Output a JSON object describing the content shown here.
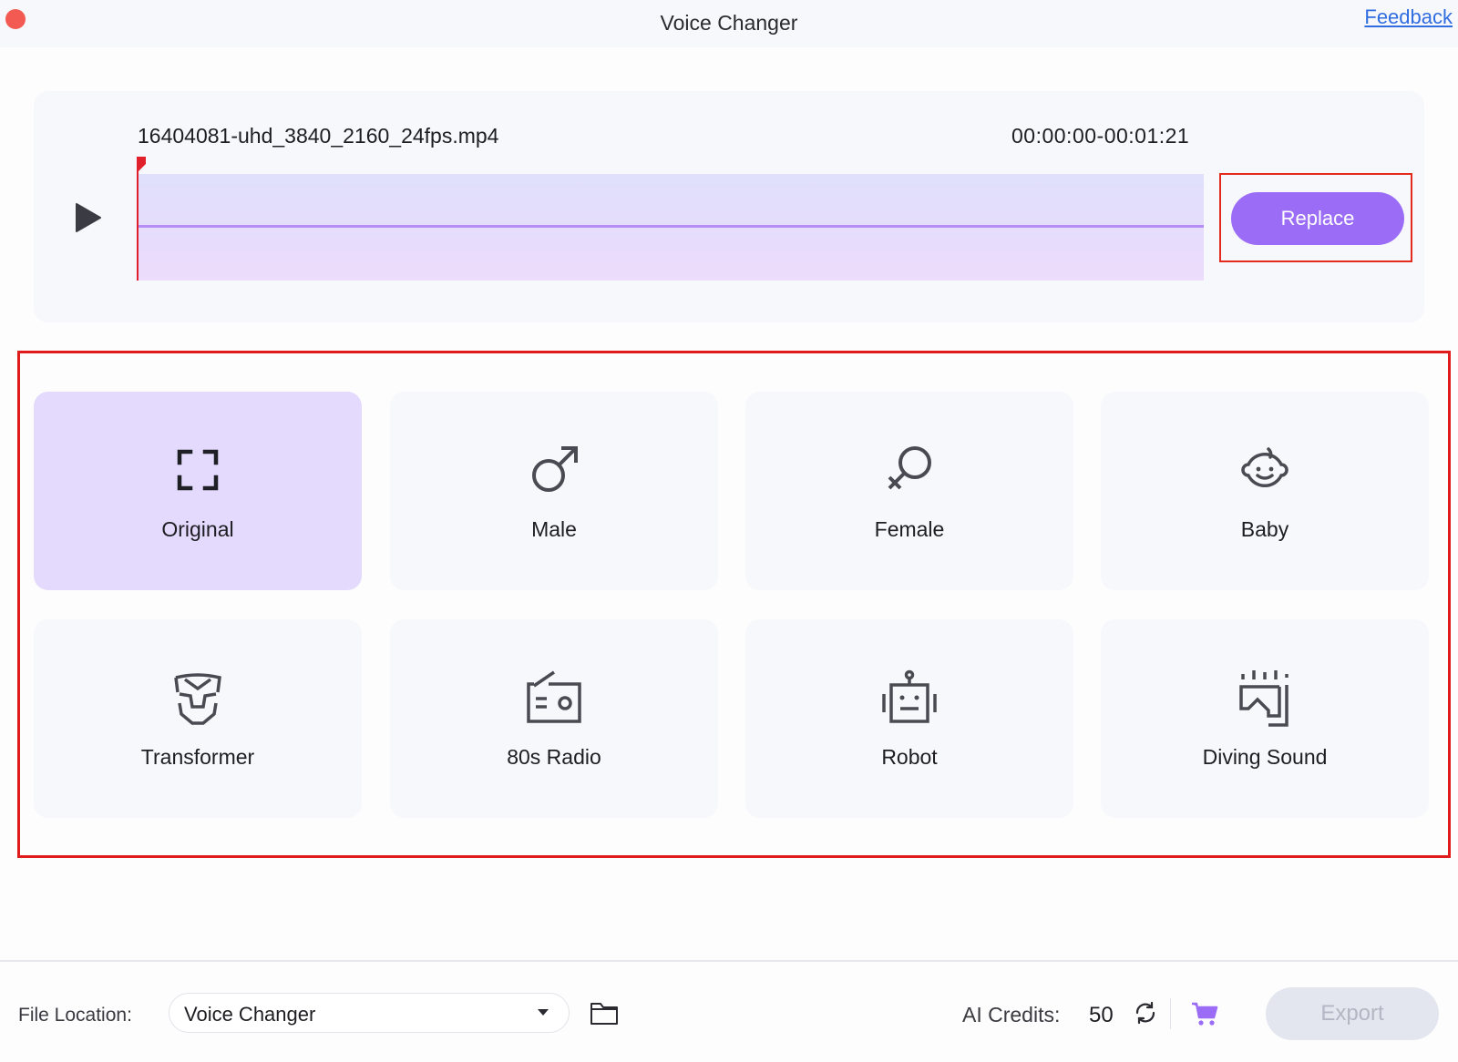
{
  "window": {
    "title": "Voice Changer",
    "feedback_link": "Feedback"
  },
  "media": {
    "file_name": "16404081-uhd_3840_2160_24fps.mp4",
    "time_range": "00:00:00-00:01:21",
    "playhead_position": 0,
    "replace_label": "Replace"
  },
  "effects": {
    "selected": "Original",
    "items": [
      {
        "label": "Original",
        "icon": "original-frame-icon",
        "selected": true
      },
      {
        "label": "Male",
        "icon": "male-symbol-icon",
        "selected": false
      },
      {
        "label": "Female",
        "icon": "female-symbol-icon",
        "selected": false
      },
      {
        "label": "Baby",
        "icon": "baby-face-icon",
        "selected": false
      },
      {
        "label": "Transformer",
        "icon": "transformer-mask-icon",
        "selected": false
      },
      {
        "label": "80s Radio",
        "icon": "radio-icon",
        "selected": false
      },
      {
        "label": "Robot",
        "icon": "robot-icon",
        "selected": false
      },
      {
        "label": "Diving Sound",
        "icon": "diving-mask-icon",
        "selected": false
      }
    ]
  },
  "footer": {
    "file_location_label": "File Location:",
    "file_location_value": "Voice Changer",
    "ai_credits_label": "AI Credits:",
    "ai_credits_value": "50",
    "export_label": "Export",
    "export_enabled": false
  },
  "colors": {
    "accent": "#9b6cf6",
    "selected_card": "#e3dafd",
    "playhead": "#e0202a",
    "annotation_outline": "#e01b1b",
    "link": "#2f6de0",
    "cart": "#9b6cf6"
  }
}
